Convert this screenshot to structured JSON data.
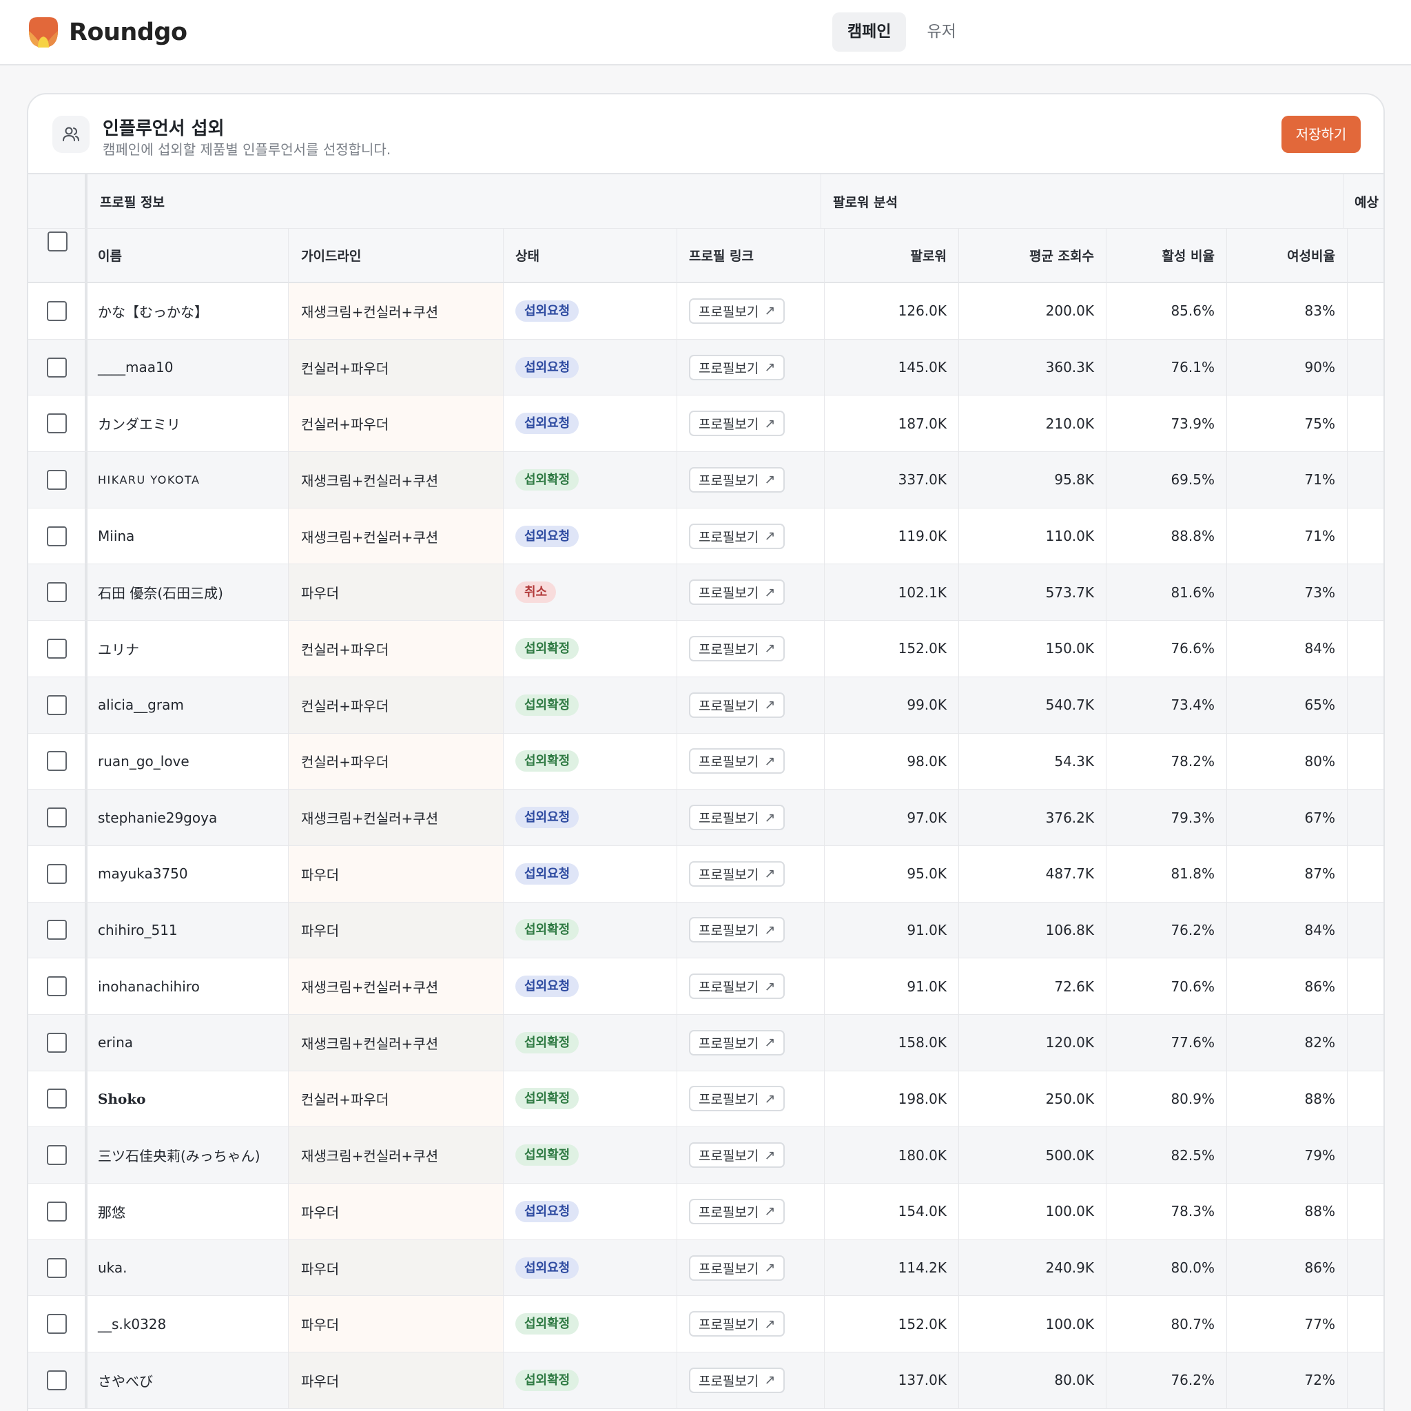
{
  "brand": {
    "name": "Roundgo"
  },
  "nav": {
    "tabs": [
      "캠페인",
      "유저"
    ],
    "active": 0
  },
  "card": {
    "title": "인플루언서 섭외",
    "subtitle": "캠페인에 섭외할 제품별 인플루언서를 선정합니다.",
    "save_label": "저장하기",
    "icon": "users-icon"
  },
  "table": {
    "groups": {
      "profile": "프로필 정보",
      "follower": "팔로워 분석",
      "extra": "예상"
    },
    "columns": {
      "name": "이름",
      "guide": "가이드라인",
      "status": "상태",
      "link": "프로필 링크",
      "followers": "팔로워",
      "avg_views": "평균 조회수",
      "active": "활성 비율",
      "female": "여성비율"
    },
    "link_label": "프로필보기",
    "rows": [
      {
        "name": "かな【むっかな】",
        "guide": "재생크림+컨실러+쿠션",
        "status": "섭외요청",
        "kind": "req",
        "followers": "126.0K",
        "avg": "200.0K",
        "active": "85.6%",
        "female": "83%"
      },
      {
        "name": "____maa10",
        "guide": "컨실러+파우더",
        "status": "섭외요청",
        "kind": "req",
        "followers": "145.0K",
        "avg": "360.3K",
        "active": "76.1%",
        "female": "90%"
      },
      {
        "name": "カンダエミリ",
        "guide": "컨실러+파우더",
        "status": "섭외요청",
        "kind": "req",
        "followers": "187.0K",
        "avg": "210.0K",
        "active": "73.9%",
        "female": "75%"
      },
      {
        "name": "HIKARU YOKOTA",
        "guide": "재생크림+컨실러+쿠션",
        "status": "섭외확정",
        "kind": "conf",
        "followers": "337.0K",
        "avg": "95.8K",
        "active": "69.5%",
        "female": "71%",
        "style": "caps"
      },
      {
        "name": "Miina",
        "guide": "재생크림+컨실러+쿠션",
        "status": "섭외요청",
        "kind": "req",
        "followers": "119.0K",
        "avg": "110.0K",
        "active": "88.8%",
        "female": "71%"
      },
      {
        "name": "石田 優奈(石田三成)",
        "guide": "파우더",
        "status": "취소",
        "kind": "cancel",
        "followers": "102.1K",
        "avg": "573.7K",
        "active": "81.6%",
        "female": "73%"
      },
      {
        "name": "ユリナ",
        "guide": "컨실러+파우더",
        "status": "섭외확정",
        "kind": "conf",
        "followers": "152.0K",
        "avg": "150.0K",
        "active": "76.6%",
        "female": "84%"
      },
      {
        "name": "alicia__gram",
        "guide": "컨실러+파우더",
        "status": "섭외확정",
        "kind": "conf",
        "followers": "99.0K",
        "avg": "540.7K",
        "active": "73.4%",
        "female": "65%"
      },
      {
        "name": "ruan_go_love",
        "guide": "컨실러+파우더",
        "status": "섭외확정",
        "kind": "conf",
        "followers": "98.0K",
        "avg": "54.3K",
        "active": "78.2%",
        "female": "80%"
      },
      {
        "name": "stephanie29goya",
        "guide": "재생크림+컨실러+쿠션",
        "status": "섭외요청",
        "kind": "req",
        "followers": "97.0K",
        "avg": "376.2K",
        "active": "79.3%",
        "female": "67%"
      },
      {
        "name": "mayuka3750",
        "guide": "파우더",
        "status": "섭외요청",
        "kind": "req",
        "followers": "95.0K",
        "avg": "487.7K",
        "active": "81.8%",
        "female": "87%"
      },
      {
        "name": "chihiro_511",
        "guide": "파우더",
        "status": "섭외확정",
        "kind": "conf",
        "followers": "91.0K",
        "avg": "106.8K",
        "active": "76.2%",
        "female": "84%"
      },
      {
        "name": "inohanachihiro",
        "guide": "재생크림+컨실러+쿠션",
        "status": "섭외요청",
        "kind": "req",
        "followers": "91.0K",
        "avg": "72.6K",
        "active": "70.6%",
        "female": "86%"
      },
      {
        "name": "erina",
        "guide": "재생크림+컨실러+쿠션",
        "status": "섭외확정",
        "kind": "conf",
        "followers": "158.0K",
        "avg": "120.0K",
        "active": "77.6%",
        "female": "82%"
      },
      {
        "name": "Shoko",
        "guide": "컨실러+파우더",
        "status": "섭외확정",
        "kind": "conf",
        "followers": "198.0K",
        "avg": "250.0K",
        "active": "80.9%",
        "female": "88%",
        "style": "serif"
      },
      {
        "name": "三ツ石佳央莉(みっちゃん)",
        "guide": "재생크림+컨실러+쿠션",
        "status": "섭외확정",
        "kind": "conf",
        "followers": "180.0K",
        "avg": "500.0K",
        "active": "82.5%",
        "female": "79%"
      },
      {
        "name": "那悠",
        "guide": "파우더",
        "status": "섭외요청",
        "kind": "req",
        "followers": "154.0K",
        "avg": "100.0K",
        "active": "78.3%",
        "female": "88%"
      },
      {
        "name": "uka.",
        "guide": "파우더",
        "status": "섭외요청",
        "kind": "req",
        "followers": "114.2K",
        "avg": "240.9K",
        "active": "80.0%",
        "female": "86%"
      },
      {
        "name": "__s.k0328",
        "guide": "파우더",
        "status": "섭외확정",
        "kind": "conf",
        "followers": "152.0K",
        "avg": "100.0K",
        "active": "80.7%",
        "female": "77%"
      },
      {
        "name": "さやべび",
        "guide": "파우더",
        "status": "섭외확정",
        "kind": "conf",
        "followers": "137.0K",
        "avg": "80.0K",
        "active": "76.2%",
        "female": "72%"
      }
    ]
  }
}
